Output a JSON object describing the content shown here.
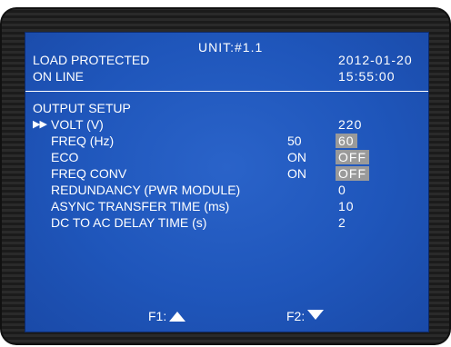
{
  "header": {
    "unit": "UNIT:#1.1",
    "status_line1": "LOAD PROTECTED",
    "status_line2": "ON LINE",
    "date": "2012-01-20",
    "time": "15:55:00"
  },
  "section_title": "OUTPUT SETUP",
  "cursor_glyph": "▶▶",
  "rows": [
    {
      "label": "VOLT (V)",
      "current": "",
      "setting": "220",
      "highlighted": false
    },
    {
      "label": "FREQ (Hz)",
      "current": "50",
      "setting": "60",
      "highlighted": true
    },
    {
      "label": "ECO",
      "current": "ON",
      "setting": "OFF",
      "highlighted": true
    },
    {
      "label": "FREQ CONV",
      "current": "ON",
      "setting": "OFF",
      "highlighted": true
    },
    {
      "label": "REDUNDANCY (PWR MODULE)",
      "current": "",
      "setting": "0",
      "highlighted": false
    },
    {
      "label": "ASYNC TRANSFER TIME (ms)",
      "current": "",
      "setting": "10",
      "highlighted": false
    },
    {
      "label": "DC TO AC DELAY TIME (s)",
      "current": "",
      "setting": "2",
      "highlighted": false
    }
  ],
  "footer": {
    "f1_label": "F1:",
    "f1_icon": "up-triangle",
    "f2_label": "F2:",
    "f2_icon": "down-triangle"
  },
  "colors": {
    "screen_bg": "#1f56bb",
    "highlight_bg": "#9a9a9a",
    "text": "#ffffff",
    "bezel": "#242424"
  }
}
